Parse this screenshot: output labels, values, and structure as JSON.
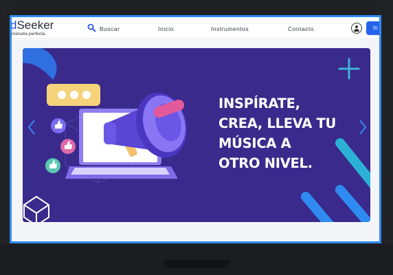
{
  "brand": {
    "name_accent": "d",
    "name_rest": "Seeker",
    "tagline": "melodía perfecta."
  },
  "nav": {
    "search_label": "Buscar",
    "items": [
      "Inicio",
      "Instrumentos",
      "Contacto"
    ],
    "login_label": "In"
  },
  "banner": {
    "headline_lines": [
      "INSPÍRATE,",
      "CREA, LLEVA TU",
      "MÚSICA A",
      "OTRO NIVEL."
    ],
    "background": "#3a2a8c"
  },
  "colors": {
    "accent": "#2563eb",
    "frame": "#2f8bf1"
  },
  "icons": [
    "search-icon",
    "user-icon",
    "chevron-left-icon",
    "chevron-right-icon",
    "megaphone-icon",
    "laptop-icon",
    "thumbs-up-icon",
    "heart-icon",
    "plus-icon",
    "cube-icon",
    "chat-bubble-icon"
  ]
}
